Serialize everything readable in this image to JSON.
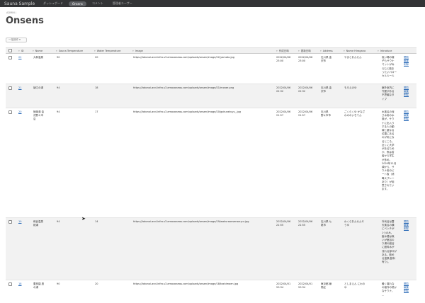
{
  "navbar": {
    "brand": "Sauna Sample",
    "items": [
      {
        "label": "ダッシュボード",
        "active": false
      },
      {
        "label": "Onsens",
        "active": true
      },
      {
        "label": "コメント",
        "active": false
      },
      {
        "label": "管理者ユーザー",
        "active": false
      }
    ]
  },
  "breadcrumb": "ADMIN /",
  "page_title": "Onsens",
  "batch_button": "一括操作 ▾",
  "columns": {
    "id": "ID",
    "name": "Name",
    "sauna": "Sauna Temperature",
    "water": "Water Temperature",
    "image": "Image",
    "created": "作成日時",
    "updated": "更新日時",
    "address": "Address",
    "hiragana": "Name Hiragana",
    "introduce": "Introduce"
  },
  "actions": {
    "view": "閲覧",
    "edit": "編集",
    "delete": "削除"
  },
  "rows": [
    {
      "id": "22",
      "name": "大和温泉",
      "sauna": "90",
      "water": "20",
      "image": "https://totonoi-and-infra.s3.amazonaws.com/uploads/onsen/image/22/yamato.jpg",
      "created": "2022/04/06\n23:00",
      "updated": "2022/04/06\n23:00",
      "address": "石川県 金\n沢市",
      "hiragana": "やまとおんせん",
      "introduce": "炭い場の寝\n子もサウナ\nマットがね\nらむと飲ま\nったいパロー\nカルルール"
    },
    {
      "id": "21",
      "name": "諸江の湯",
      "sauna": "94",
      "water": "18",
      "image": "https://totonoi-and-infra.s3.amazonaws.com/uploads/onsen/image/21/morae.png",
      "created": "2022/04/06\n22:32",
      "updated": "2022/04/06\n22:32",
      "address": "石川県 金\n沢市",
      "hiragana": "もろえのゆ",
      "introduce": "館外室内に\n守屋がある\n不思議なタ\nイプ"
    },
    {
      "id": "20",
      "name": "極楽湯 金\n沢野々市\n店",
      "sauna": "94",
      "water": "17",
      "image": "https://totonoi-and-infra.s3.amazonaws.com/uploads/onsen/image/20/gokurakuyu_.jpg",
      "created": "2022/04/06\n21:57",
      "updated": "2022/04/06\n21:57",
      "address": "石川県\n野々市市",
      "hiragana": "ごくらくゆ かなざ\nわののいちてん",
      "introduce": "水風呂の深\nさ水用の水\n風が。サウ\nナに出入り\nする人の動\n線と重なる\n位置にある\nのが気にな\nるところ。\n近くに大学\nがあるため\nか、夜は若\n者から学生\nが多め。\n2020年11月\n頃から、サ\nウナ用のビ\nート板（消\n毒スプレー\nあり）が用\n意されてい\nます。"
    },
    {
      "id": "19",
      "name": "和倉温泉\n総湯",
      "sauna": "94",
      "water": "14",
      "image": "https://totonoi-and-infra.s3.amazonaws.com/uploads/onsen/image/19/wakuraonsensouyu.jpg",
      "created": "2022/04/06\n21:55",
      "updated": "2022/04/06\n21:55",
      "address": "石川県 七\n尾市",
      "hiragana": "わくらおんせんそ\nうゆ",
      "introduce": "外気浴は露\n天風呂の横\nにベンチが\n1つのみ。\n館水槽は無\nいが館浴の\nり湯の館浴\nに館料水が\n流れる部口が\nある。飲め\nる温泉(飲料\n有り)。"
    },
    {
      "id": "18",
      "name": "豊島園 庭\nの湯",
      "sauna": "90",
      "water": "20",
      "image": "https://totonoi-and-infra.s3.amazonaws.com/uploads/onsen/image/18/toshimaen.jpg",
      "created": "2022/04/01\n20:34",
      "updated": "2022/04/01\n20:34",
      "address": "東京都 練\n馬区",
      "hiragana": "としまえん にわの\nゆ",
      "introduce": "暖く寝れな\nの極作の熱か\nなサウナ。\n..."
    }
  ]
}
